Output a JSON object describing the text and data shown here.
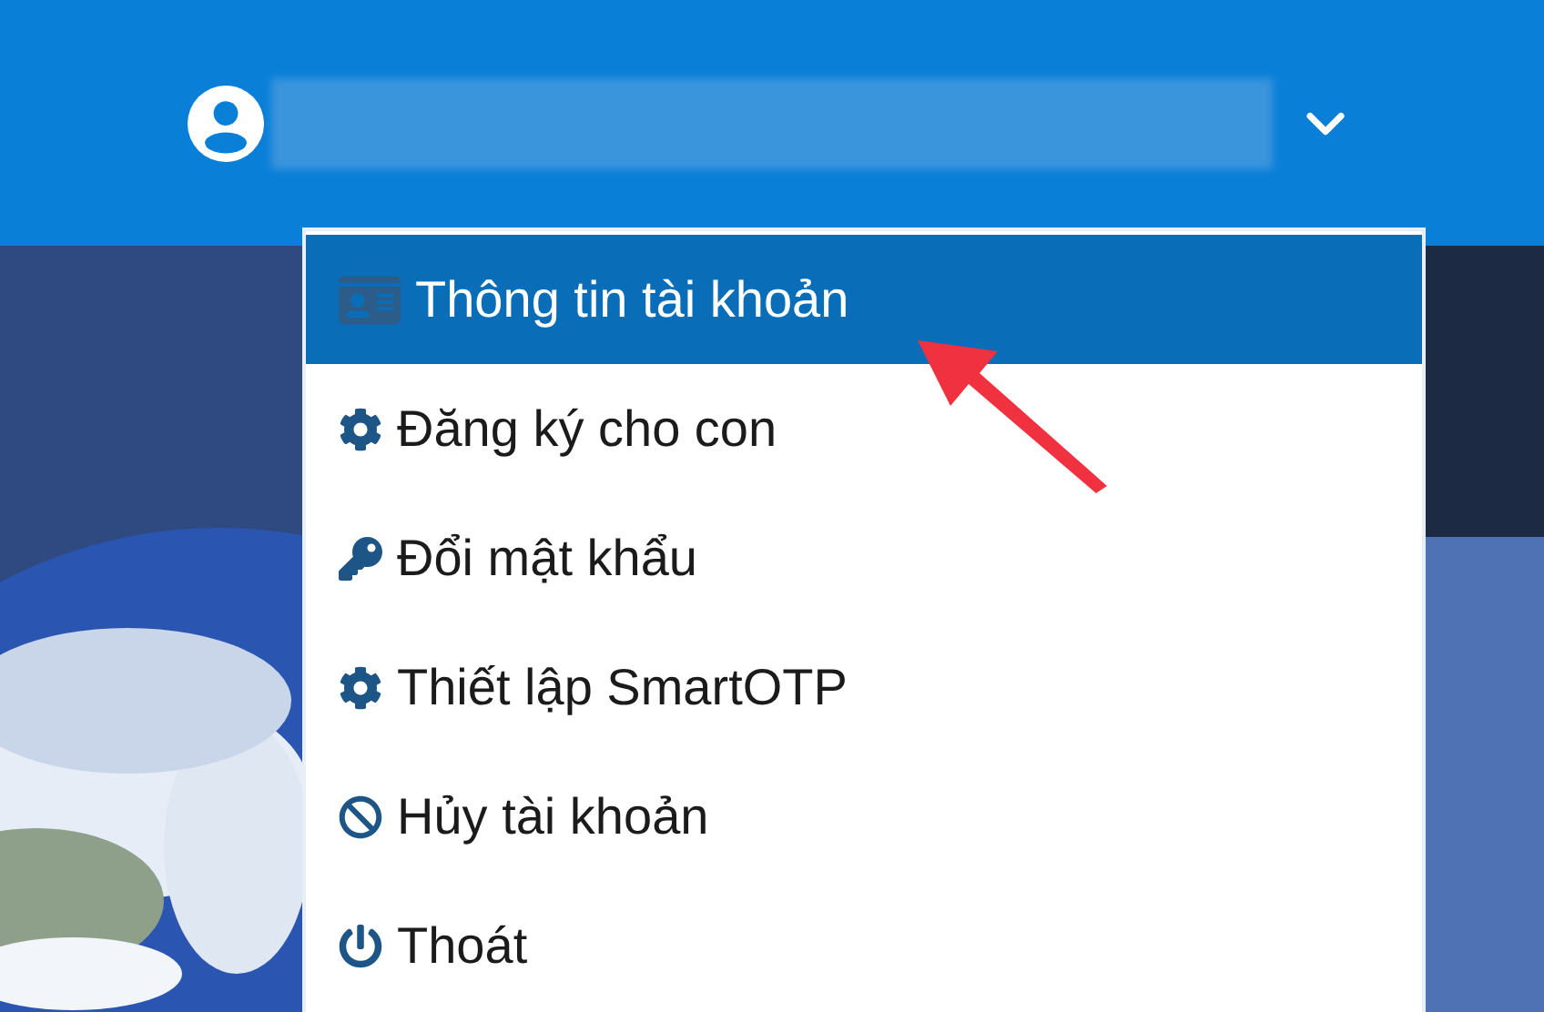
{
  "menu": {
    "expanded": true,
    "items": [
      {
        "label": "Thông tin tài khoản",
        "kind": "id-card",
        "selected": true
      },
      {
        "label": "Đăng ký cho con",
        "kind": "gear",
        "selected": false
      },
      {
        "label": "Đổi mật khẩu",
        "kind": "key",
        "selected": false
      },
      {
        "label": "Thiết lập SmartOTP",
        "kind": "gear",
        "selected": false
      },
      {
        "label": "Hủy tài khoản",
        "kind": "ban",
        "selected": false
      },
      {
        "label": "Thoát",
        "kind": "power",
        "selected": false
      }
    ]
  }
}
